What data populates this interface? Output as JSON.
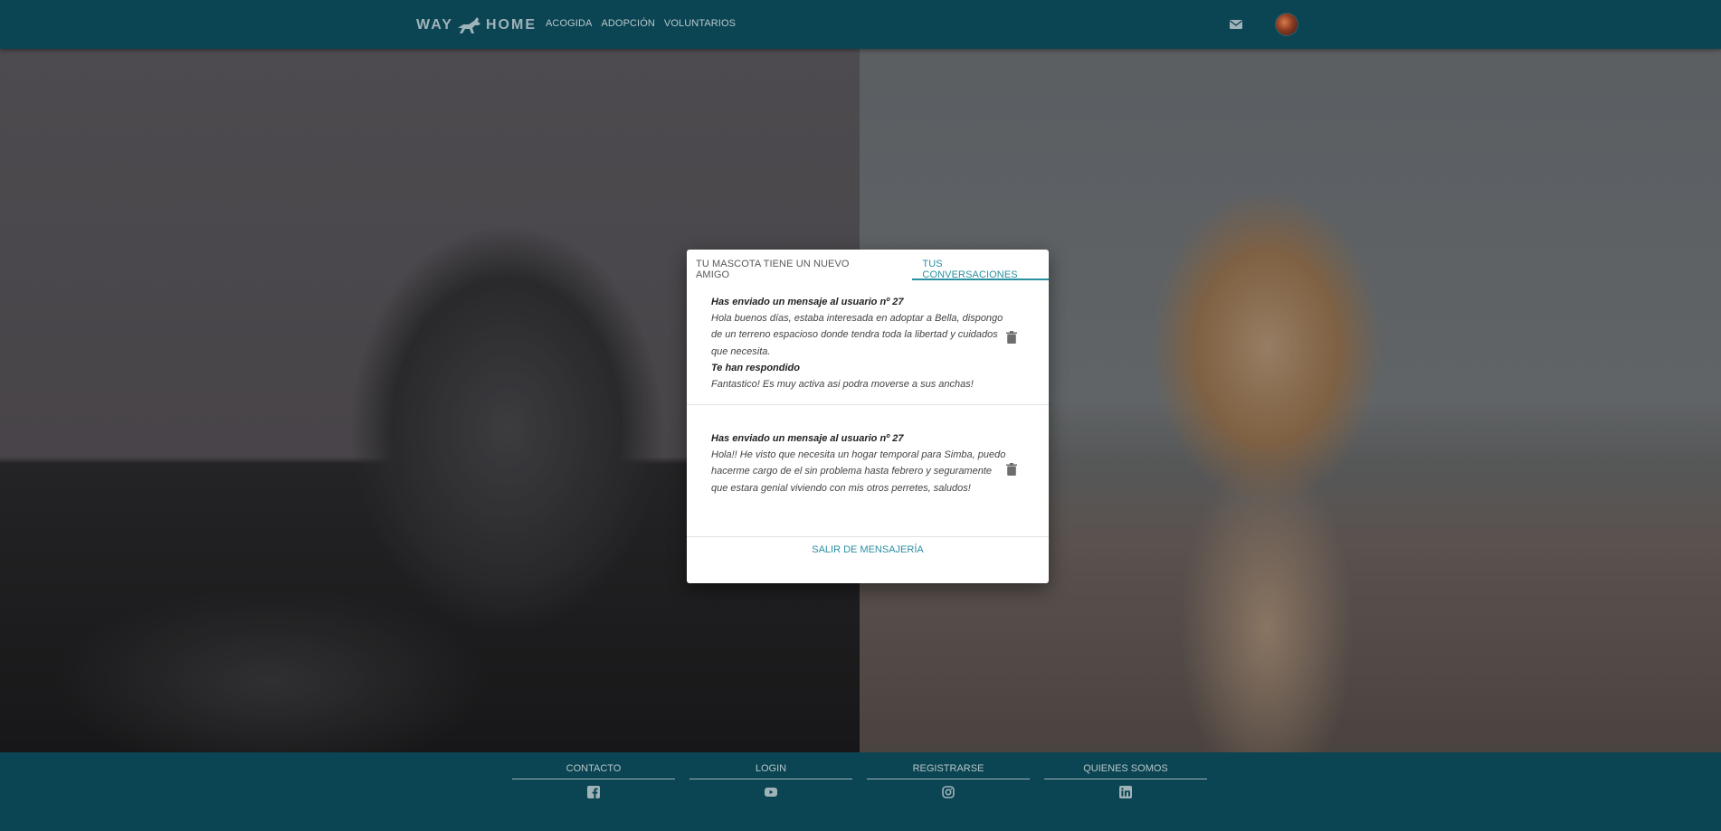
{
  "header": {
    "logo_left": "WAY",
    "logo_right": "HOME",
    "nav": [
      "ACOGIDA",
      "ADOPCIÓN",
      "VOLUNTARIOS"
    ],
    "icons": [
      "mail-icon",
      "avatar"
    ]
  },
  "modal": {
    "tabs": [
      "TU MASCOTA TIENE UN NUEVO AMIGO",
      "TUS CONVERSACIONES"
    ],
    "active_tab": "TUS CONVERSACIONES",
    "conversations": [
      {
        "sent_title": "Has enviado un mensaje al usuario nº 27",
        "sent_text": "Hola buenos días, estaba interesada en adoptar a Bella, dispongo de un terreno espacioso donde tendra toda la libertad y cuidados que necesita.",
        "reply_title": "Te han respondido",
        "reply_text": "Fantastico! Es muy activa asi podra moverse a sus anchas!"
      },
      {
        "sent_title": "Has enviado un mensaje al usuario nº 27",
        "sent_text": "Hola!! He visto que necesita un hogar temporal para Simba, puedo hacerme cargo de el sin problema hasta febrero y seguramente que estara genial viviendo con mis otros perretes, saludos!"
      }
    ],
    "exit_label": "SALIR DE MENSAJERÍA"
  },
  "footer": {
    "columns": [
      {
        "label": "CONTACTO",
        "icon": "facebook-icon"
      },
      {
        "label": "LOGIN",
        "icon": "youtube-icon"
      },
      {
        "label": "REGISTRARSE",
        "icon": "instagram-icon"
      },
      {
        "label": "QUIENES SOMOS",
        "icon": "linkedin-icon"
      }
    ]
  },
  "colors": {
    "header_bg": "#0b4452",
    "accent": "#2a8fa0",
    "modal_bg": "#ffffff"
  }
}
